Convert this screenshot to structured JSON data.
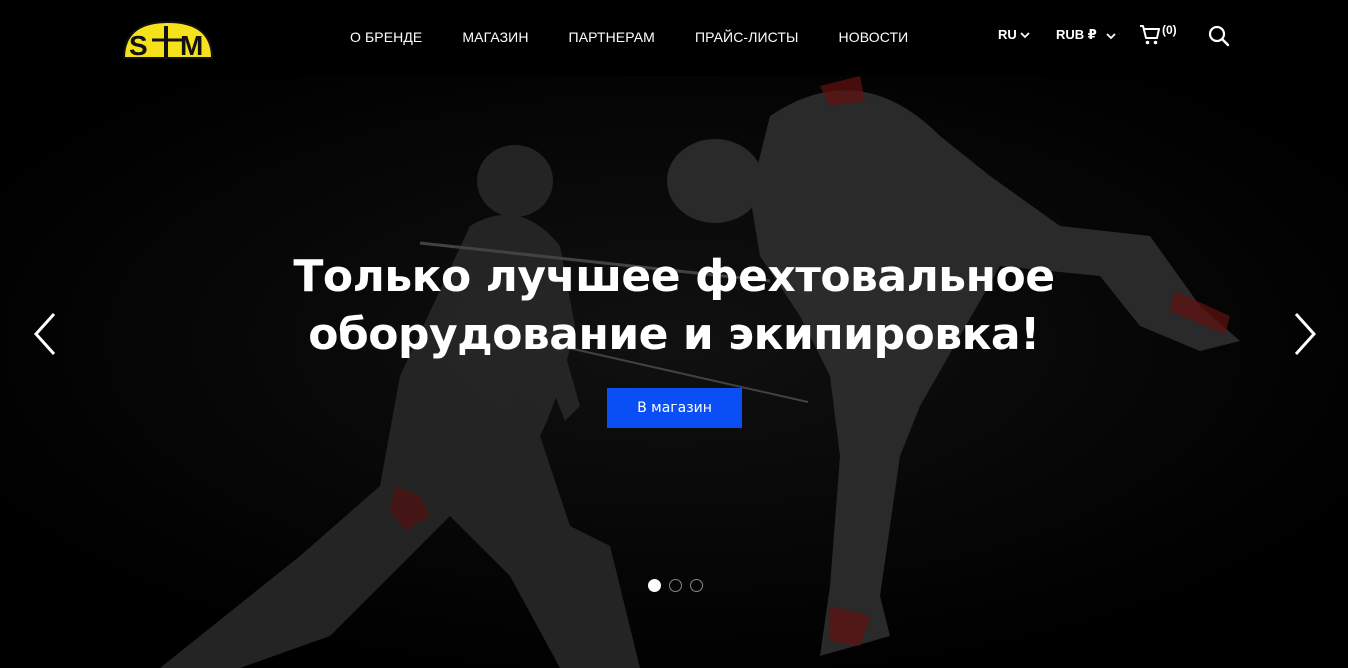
{
  "brand": {
    "logo_text": "S|M",
    "logo_color": "#f5e21a"
  },
  "nav": {
    "items": [
      {
        "label": "О БРЕНДЕ"
      },
      {
        "label": "МАГАЗИН"
      },
      {
        "label": "ПАРТНЕРАМ"
      },
      {
        "label": "ПРАЙС-ЛИСТЫ"
      },
      {
        "label": "НОВОСТИ"
      }
    ]
  },
  "header": {
    "language": "RU",
    "currency": "RUB ₽",
    "cart_count": "(0)",
    "icons": [
      "cart-icon",
      "search-icon",
      "chevron-down-icon"
    ]
  },
  "hero": {
    "title_line1": "Только лучшее фехтовальное",
    "title_line2": "оборудование и экипировка!",
    "cta_label": "В магазин",
    "cta_color": "#0a4ef5",
    "slides_total": 3,
    "active_slide": 1
  }
}
